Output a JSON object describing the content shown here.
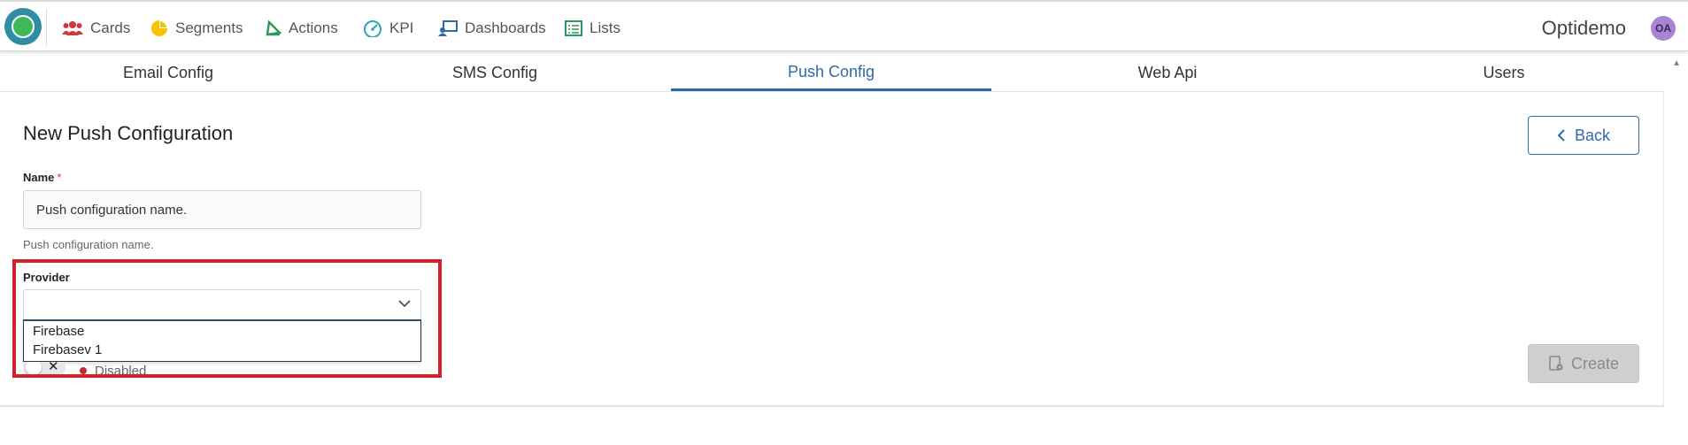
{
  "nav": {
    "items": [
      {
        "label": "Cards",
        "icon": "users-icon"
      },
      {
        "label": "Segments",
        "icon": "pie-chart-icon"
      },
      {
        "label": "Actions",
        "icon": "actions-icon"
      },
      {
        "label": "KPI",
        "icon": "gauge-icon"
      },
      {
        "label": "Dashboards",
        "icon": "dashboard-icon"
      },
      {
        "label": "Lists",
        "icon": "list-icon"
      }
    ],
    "brand": "Optidemo",
    "avatar": "OA"
  },
  "tabs": [
    {
      "label": "Email Config",
      "active": false
    },
    {
      "label": "SMS Config",
      "active": false
    },
    {
      "label": "Push Config",
      "active": true
    },
    {
      "label": "Web Api",
      "active": false
    },
    {
      "label": "Users",
      "active": false
    }
  ],
  "form": {
    "title": "New Push Configuration",
    "back_label": "Back",
    "name_label": "Name",
    "name_required": "*",
    "name_value": "Push configuration name.",
    "name_hint": "Push configuration name.",
    "provider_label": "Provider",
    "provider_value": "",
    "provider_options": [
      "Firebase",
      "Firebasev 1"
    ],
    "status_text": "Disabled",
    "create_label": "Create"
  },
  "colors": {
    "accent": "#2f6aa8",
    "highlight": "#d4202b",
    "status_disabled": "#c22b2b",
    "logo_outer": "#2e8ca3",
    "logo_inner": "#3fb957"
  }
}
